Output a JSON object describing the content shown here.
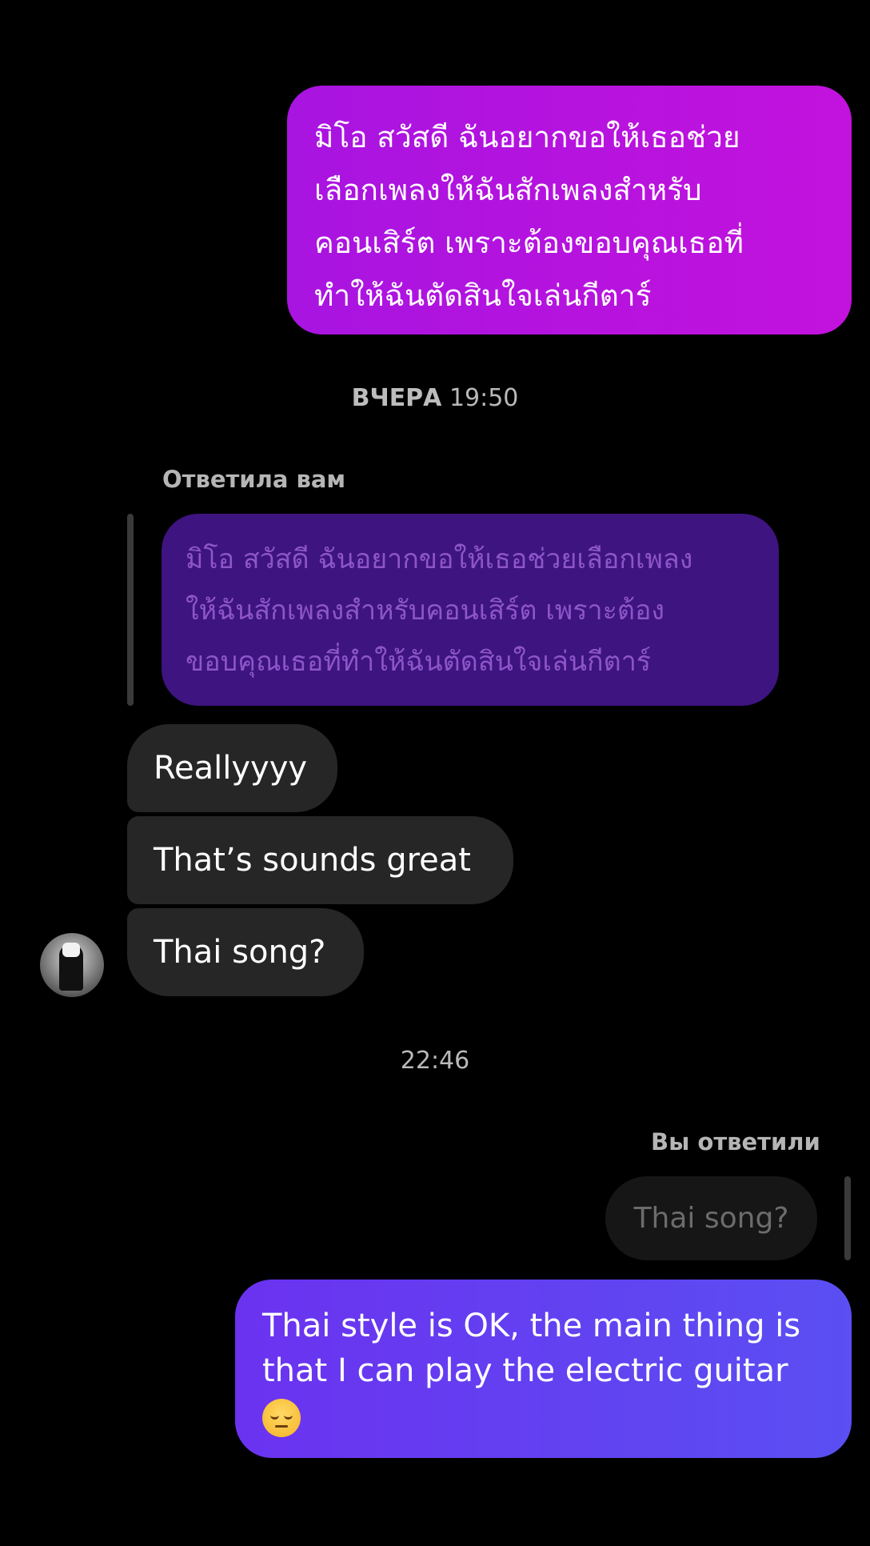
{
  "messages": {
    "outgoing_thai": "มิโอ สวัสดี ฉันอยากขอให้เธอช่วย\nเลือกเพลงให้ฉันสักเพลงสำหรับ\nคอนเสิร์ต เพราะต้องขอบคุณเธอที่\nทำให้ฉันตัดสินใจเล่นกีตาร์",
    "timestamp_1_day": "ВЧЕРА",
    "timestamp_1_time": "19:50",
    "reply_label_incoming": "Ответила вам",
    "quoted_thai": "มิโอ สวัสดี ฉันอยากขอให้เธอช่วยเลือกเพลง\nให้ฉันสักเพลงสำหรับคอนเสิร์ต เพราะต้อง\nขอบคุณเธอที่ทำให้ฉันตัดสินใจเล่นกีตาร์",
    "incoming": [
      "Reallyyyy",
      "That’s sounds great",
      "Thai song?"
    ],
    "timestamp_2": "22:46",
    "reply_label_outgoing": "Вы ответили",
    "quoted_reply": "Thai song?",
    "outgoing_english": "Thai style is OK, the main thing is that I can play the electric guitar",
    "emoji": "relieved-face-emoji"
  },
  "colors": {
    "background": "#000000",
    "outgoing_magenta": "#b814df",
    "outgoing_purple": "#5e45f2",
    "incoming_gray": "#262626",
    "quoted_purple": "#3d1480"
  }
}
